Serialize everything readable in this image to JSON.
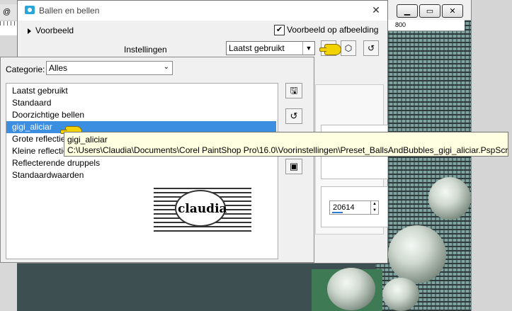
{
  "dialog": {
    "title": "Ballen en bellen",
    "close_glyph": "✕",
    "preview_toggle_label": "Voorbeeld",
    "preview_on_image_label": "Voorbeeld op afbeelding",
    "preview_on_image_checked": true,
    "settings_label": "Instellingen",
    "preset_value": "Laatst gebruikt",
    "number_value": "20614"
  },
  "doc_tab": {
    "label": "@ 1"
  },
  "psp_window": {
    "ruler_mark": "800"
  },
  "popup": {
    "category_label": "Categorie:",
    "category_value": "Alles",
    "items": [
      {
        "label": "Laatst gebruikt",
        "selected": false
      },
      {
        "label": "Standaard",
        "selected": false
      },
      {
        "label": "Doorzichtige bellen",
        "selected": false
      },
      {
        "label": "gigi_aliciar",
        "selected": true
      },
      {
        "label": "Grote reflecties",
        "selected": false
      },
      {
        "label": "Kleine reflecties",
        "selected": false
      },
      {
        "label": "Reflecterende druppels",
        "selected": false
      },
      {
        "label": "Standaardwaarden",
        "selected": false
      }
    ],
    "thumbnail_text": "claudia"
  },
  "tooltip": {
    "line1": "gigi_aliciar",
    "line2": "C:\\Users\\Claudia\\Documents\\Corel PaintShop Pro\\16.0\\Voorinstellingen\\Preset_BallsAndBubbles_gigi_aliciar.PspScript"
  },
  "colors": {
    "selection": "#3b8ee0",
    "tooltip_bg": "#ffffe1",
    "cursor": "#f2d200"
  }
}
